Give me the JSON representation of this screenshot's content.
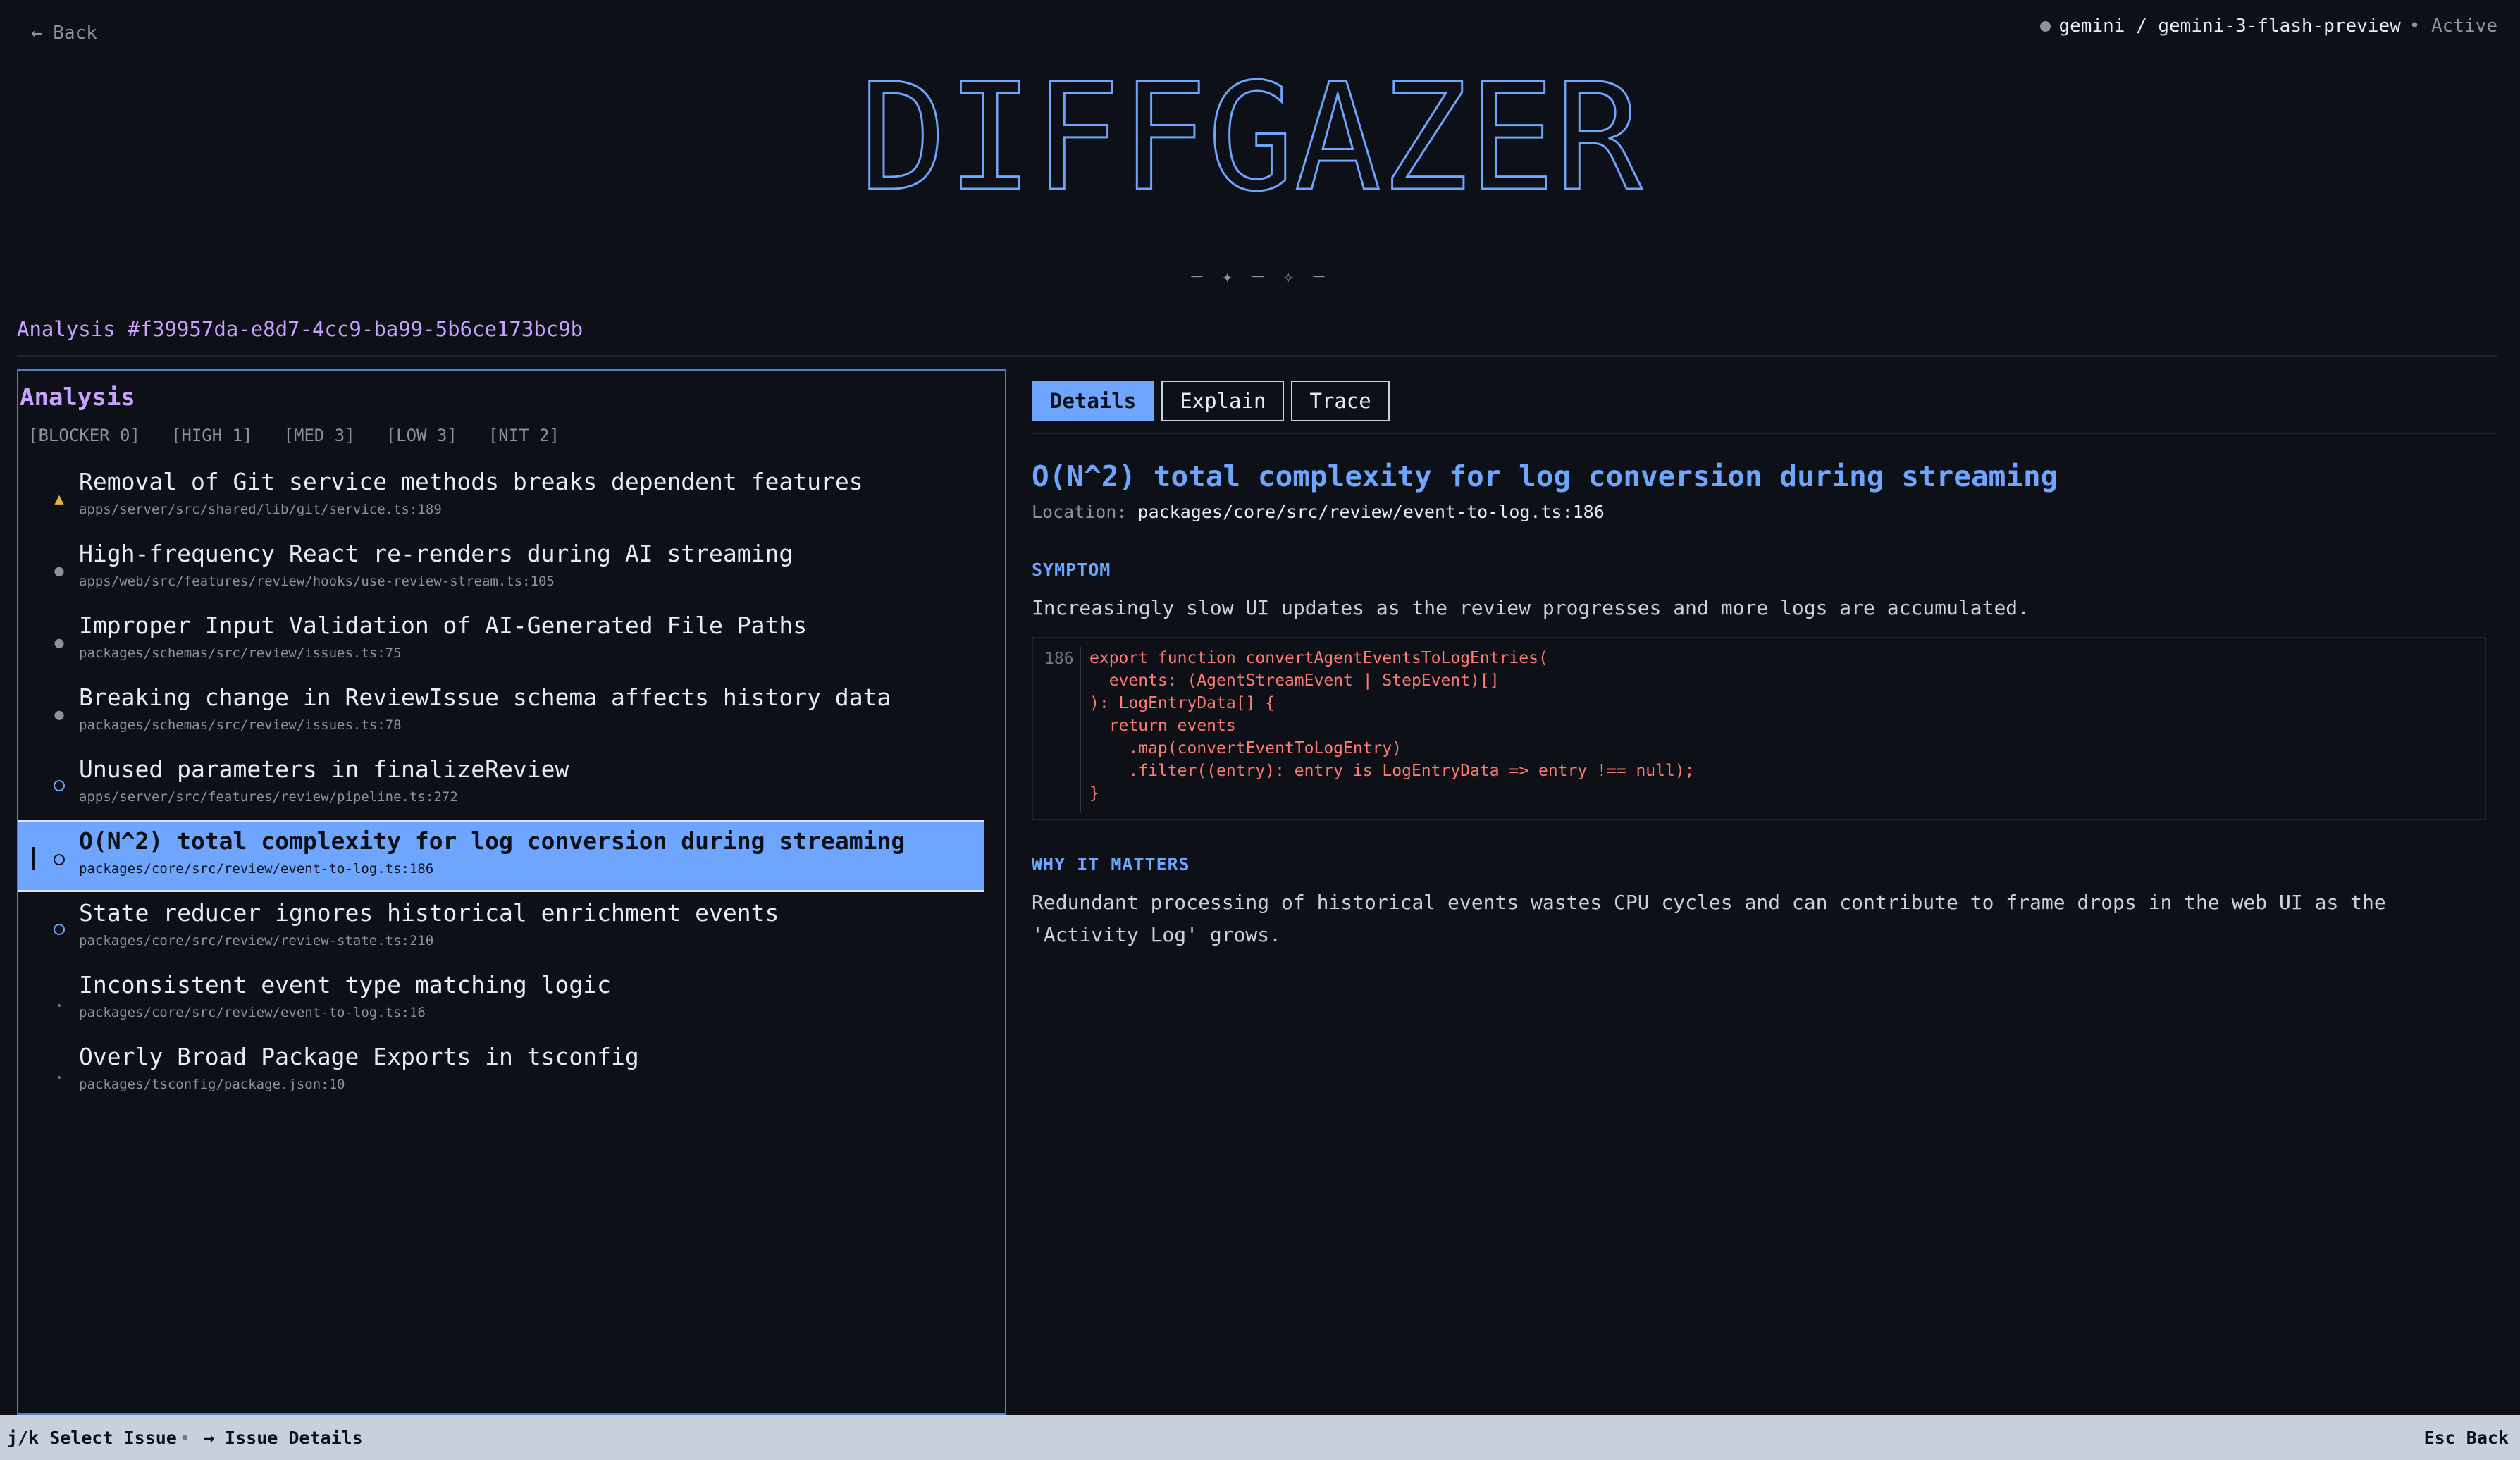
{
  "header": {
    "back_label": "← Back",
    "provider": "gemini / gemini-3-flash-preview",
    "status": "• Active",
    "logo_text": "DIFFGAZER",
    "ornament": "─ ✦ ─ ✧ ─"
  },
  "analysis_id": "Analysis #f39957da-e8d7-4cc9-ba99-5b6ce173bc9b",
  "panel": {
    "title": "Analysis",
    "counts": [
      "[BLOCKER 0]",
      "[HIGH 1]",
      "[MED 3]",
      "[LOW 3]",
      "[NIT 2]"
    ],
    "issues": [
      {
        "title": "Removal of Git service methods breaks dependent features",
        "path": "apps/server/src/shared/lib/git/service.ts:189",
        "severity": "high"
      },
      {
        "title": "High-frequency React re-renders during AI streaming",
        "path": "apps/web/src/features/review/hooks/use-review-stream.ts:105",
        "severity": "med"
      },
      {
        "title": "Improper Input Validation of AI-Generated File Paths",
        "path": "packages/schemas/src/review/issues.ts:75",
        "severity": "med"
      },
      {
        "title": "Breaking change in ReviewIssue schema affects history data",
        "path": "packages/schemas/src/review/issues.ts:78",
        "severity": "med"
      },
      {
        "title": "Unused parameters in finalizeReview",
        "path": "apps/server/src/features/review/pipeline.ts:272",
        "severity": "low"
      },
      {
        "title": "O(N^2) total complexity for log conversion during streaming",
        "path": "packages/core/src/review/event-to-log.ts:186",
        "severity": "low"
      },
      {
        "title": "State reducer ignores historical enrichment events",
        "path": "packages/core/src/review/review-state.ts:210",
        "severity": "low"
      },
      {
        "title": "Inconsistent event type matching logic",
        "path": "packages/core/src/review/event-to-log.ts:16",
        "severity": "nit"
      },
      {
        "title": "Overly Broad Package Exports in tsconfig",
        "path": "packages/tsconfig/package.json:10",
        "severity": "nit"
      }
    ]
  },
  "detail": {
    "tabs": [
      "Details",
      "Explain",
      "Trace"
    ],
    "title": "O(N^2) total complexity for log conversion during streaming",
    "location_label": "Location:",
    "location": "packages/core/src/review/event-to-log.ts:186",
    "symptom_heading": "SYMPTOM",
    "symptom": "Increasingly slow UI updates as the review progresses and more logs are accumulated.",
    "code_line": "186",
    "code": "export function convertAgentEventsToLogEntries(\n  events: (AgentStreamEvent | StepEvent)[]\n): LogEntryData[] {\n  return events\n    .map(convertEventToLogEntry)\n    .filter((entry): entry is LogEntryData => entry !== null);\n}",
    "why_heading": "WHY IT MATTERS",
    "why": "Redundant processing of historical events wastes CPU cycles and can contribute to frame drops in the web UI as the 'Activity Log' grows."
  },
  "statusbar": {
    "select": "j/k Select Issue",
    "details": "→ Issue Details",
    "back": "Esc Back"
  },
  "colors": {
    "accent": "#6ea6ff",
    "purple": "#c9a2ff",
    "warning": "#e3b341",
    "background": "#0d1117"
  }
}
